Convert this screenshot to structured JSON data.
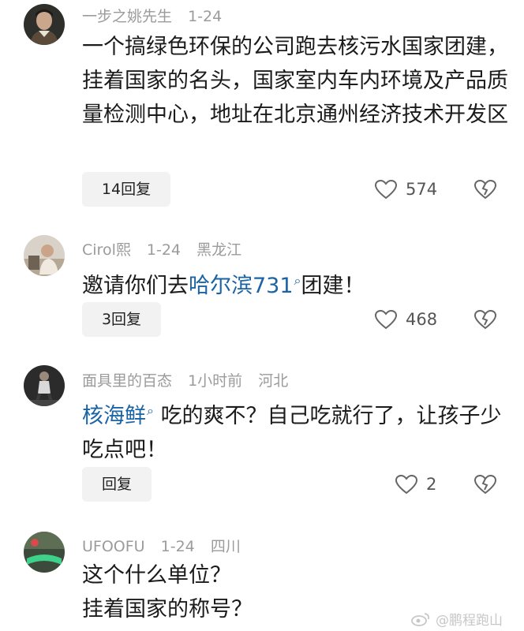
{
  "comments": [
    {
      "username": "一步之姚先生",
      "date": "1-24",
      "location": "",
      "text": "一个搞绿色环保的公司跑去核污水国家团建，挂着国家的名头，国家室内车内环境及产品质量检测中心，地址在北京通州经济技术开发区",
      "reply_label": "14回复",
      "likes": "574"
    },
    {
      "username": "Cirol熙",
      "date": "1-24",
      "location": "黑龙江",
      "text_before": "邀请你们去",
      "tag": "哈尔滨731",
      "text_after": "团建！",
      "reply_label": "3回复",
      "likes": "468"
    },
    {
      "username": "面具里的百态",
      "date": "1小时前",
      "location": "河北",
      "tag": "核海鲜",
      "text_after": "吃的爽不？自己吃就行了，让孩子少吃点吧！",
      "reply_label": "回复",
      "likes": "2"
    },
    {
      "username": "UFOOFU",
      "date": "1-24",
      "location": "四川",
      "line1": "这个什么单位？",
      "line2": "挂着国家的称号？"
    }
  ],
  "watermark": "@鹏程跑山"
}
